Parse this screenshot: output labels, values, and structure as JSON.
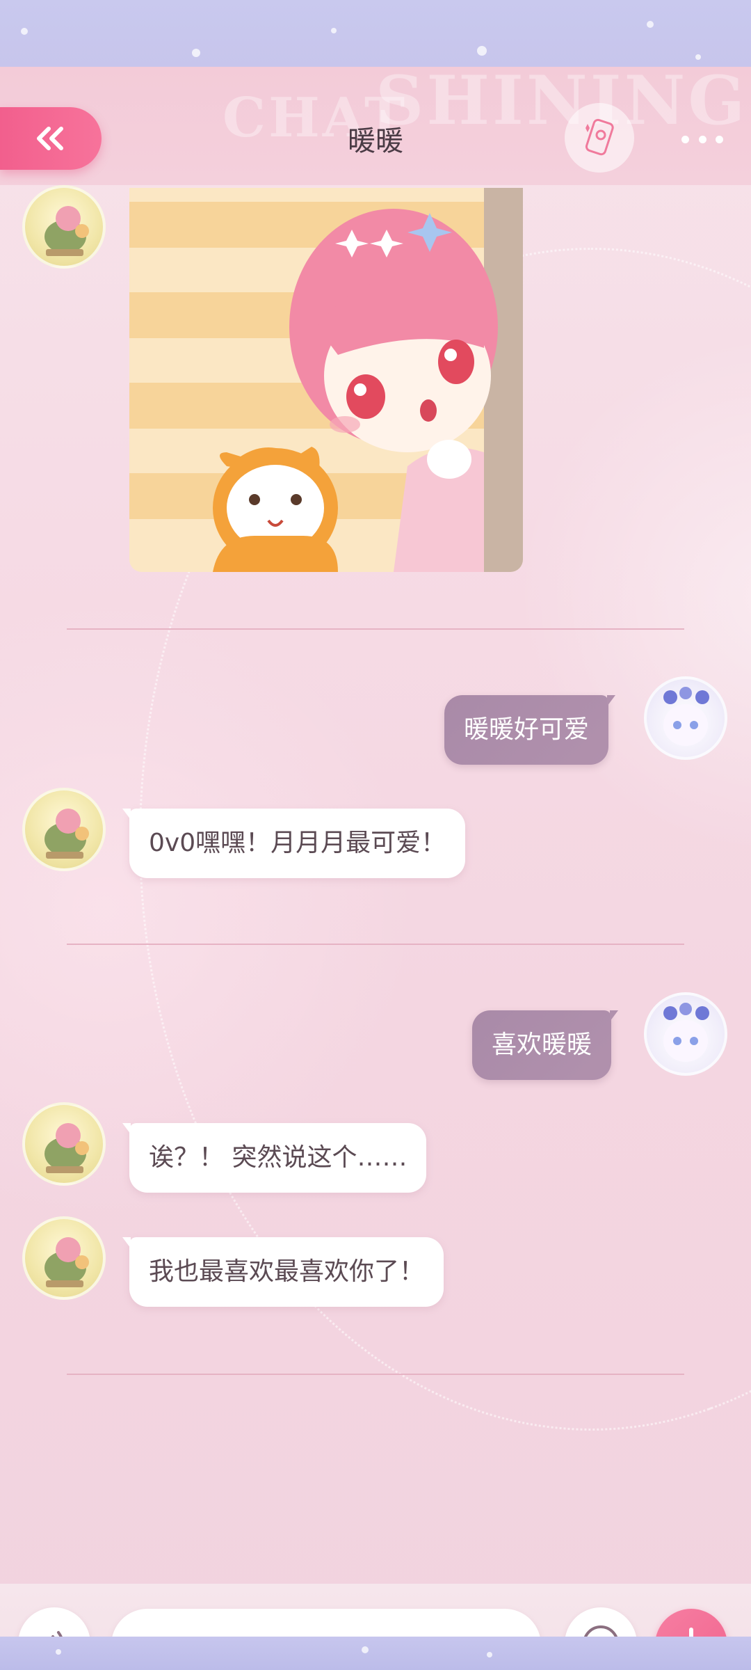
{
  "header": {
    "title": "暖暖",
    "watermark_left": "CHAT",
    "watermark_right": "SHINING",
    "back_icon": "double-chevron-left-icon",
    "badge_icon": "phone-card-icon",
    "more_icon": "more-dots-icon"
  },
  "messages": [
    {
      "side": "in",
      "type": "image",
      "sender": "暖暖"
    },
    {
      "side": "out",
      "type": "text",
      "text": "暖暖好可爱"
    },
    {
      "side": "in",
      "type": "text",
      "text": "0v0嘿嘿！月月月最可爱！"
    },
    {
      "side": "out",
      "type": "text",
      "text": "喜欢暖暖"
    },
    {
      "side": "in",
      "type": "text",
      "text": "诶？！ 突然说这个……"
    },
    {
      "side": "in",
      "type": "text",
      "text": "我也最喜欢最喜欢你了！"
    }
  ],
  "input_bar": {
    "voice_icon": "voice-icon",
    "input_value": "",
    "input_placeholder": "",
    "emoji_icon": "emoji-wink-icon",
    "plus_icon": "plus-icon"
  },
  "colors": {
    "accent_pink": "#f2648f",
    "outgoing_bubble": "#ab8ba9",
    "incoming_bubble": "#ffffff",
    "title_text": "#4a3b45",
    "background": "#f5dce5",
    "frame_lavender": "#c8c8ee"
  }
}
